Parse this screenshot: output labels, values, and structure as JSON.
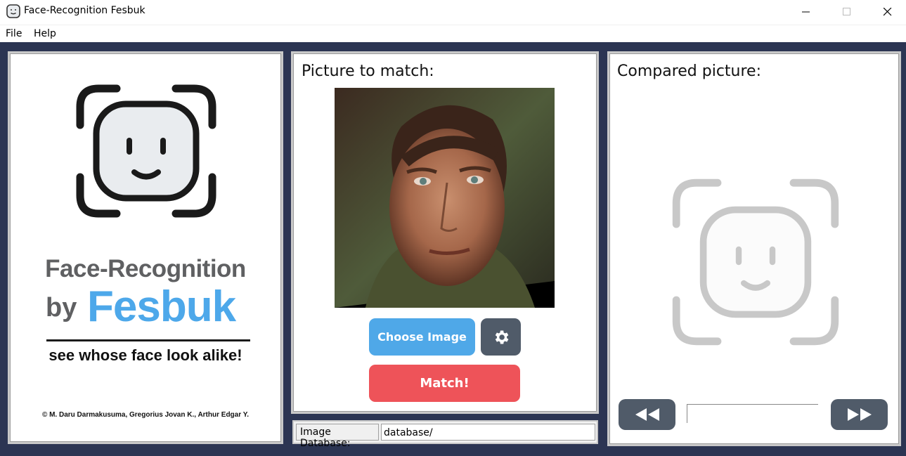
{
  "window": {
    "title": "Face-Recognition Fesbuk",
    "icon": "smiley-face-icon"
  },
  "menu": {
    "file": "File",
    "help": "Help"
  },
  "left_panel": {
    "logo_icon": "face-scan-icon",
    "brand_line1": "Face-Recognition",
    "brand_by": "by",
    "brand_name": "Fesbuk",
    "tagline": "see whose face look alike!",
    "credits": "© M. Daru Darmakusuma, Gregorius Jovan K., Arthur Edgar Y."
  },
  "middle_panel": {
    "heading": "Picture to match:",
    "choose_label": "Choose Image",
    "settings_icon": "gear-icon",
    "match_label": "Match!"
  },
  "database": {
    "label": "Image Database:",
    "value": "database/"
  },
  "right_panel": {
    "heading": "Compared picture:",
    "placeholder_icon": "face-scan-icon",
    "prev_icon": "rewind-icon",
    "next_icon": "fast-forward-icon",
    "result_name": ""
  },
  "colors": {
    "background": "#2c3553",
    "accent_blue": "#4fa8e8",
    "match_red": "#ee5359",
    "button_gray": "#505b69"
  }
}
